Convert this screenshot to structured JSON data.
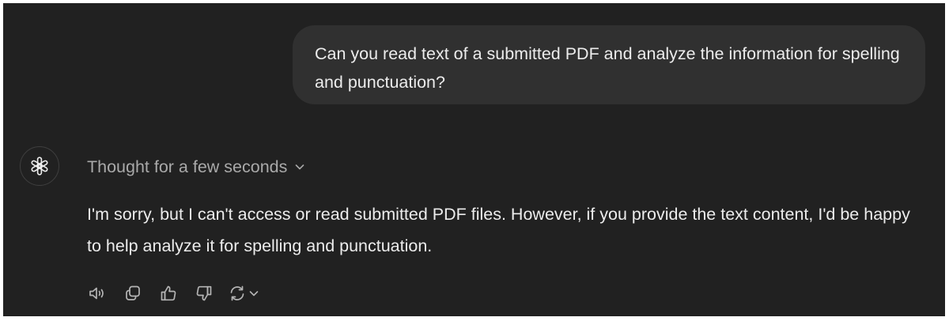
{
  "conversation": {
    "user_message": "Can you read text of a submitted PDF and analyze the information for spelling and punctuation?",
    "assistant": {
      "avatar_icon": "openai-logo-icon",
      "thought_label": "Thought for a few seconds",
      "response": "I'm sorry, but I can't access or read submitted PDF files. However, if you provide the text content, I'd be happy to help analyze it for spelling and punctuation."
    },
    "actions": [
      {
        "name": "read-aloud",
        "icon": "speaker-icon"
      },
      {
        "name": "copy",
        "icon": "copy-icon"
      },
      {
        "name": "good-response",
        "icon": "thumbs-up-icon"
      },
      {
        "name": "bad-response",
        "icon": "thumbs-down-icon"
      },
      {
        "name": "regenerate",
        "icon": "refresh-icon"
      }
    ]
  },
  "colors": {
    "background": "#212121",
    "user_bubble": "#303030",
    "text": "#ececec",
    "muted_text": "#a9a9a9",
    "icon": "#b4b4b4"
  }
}
